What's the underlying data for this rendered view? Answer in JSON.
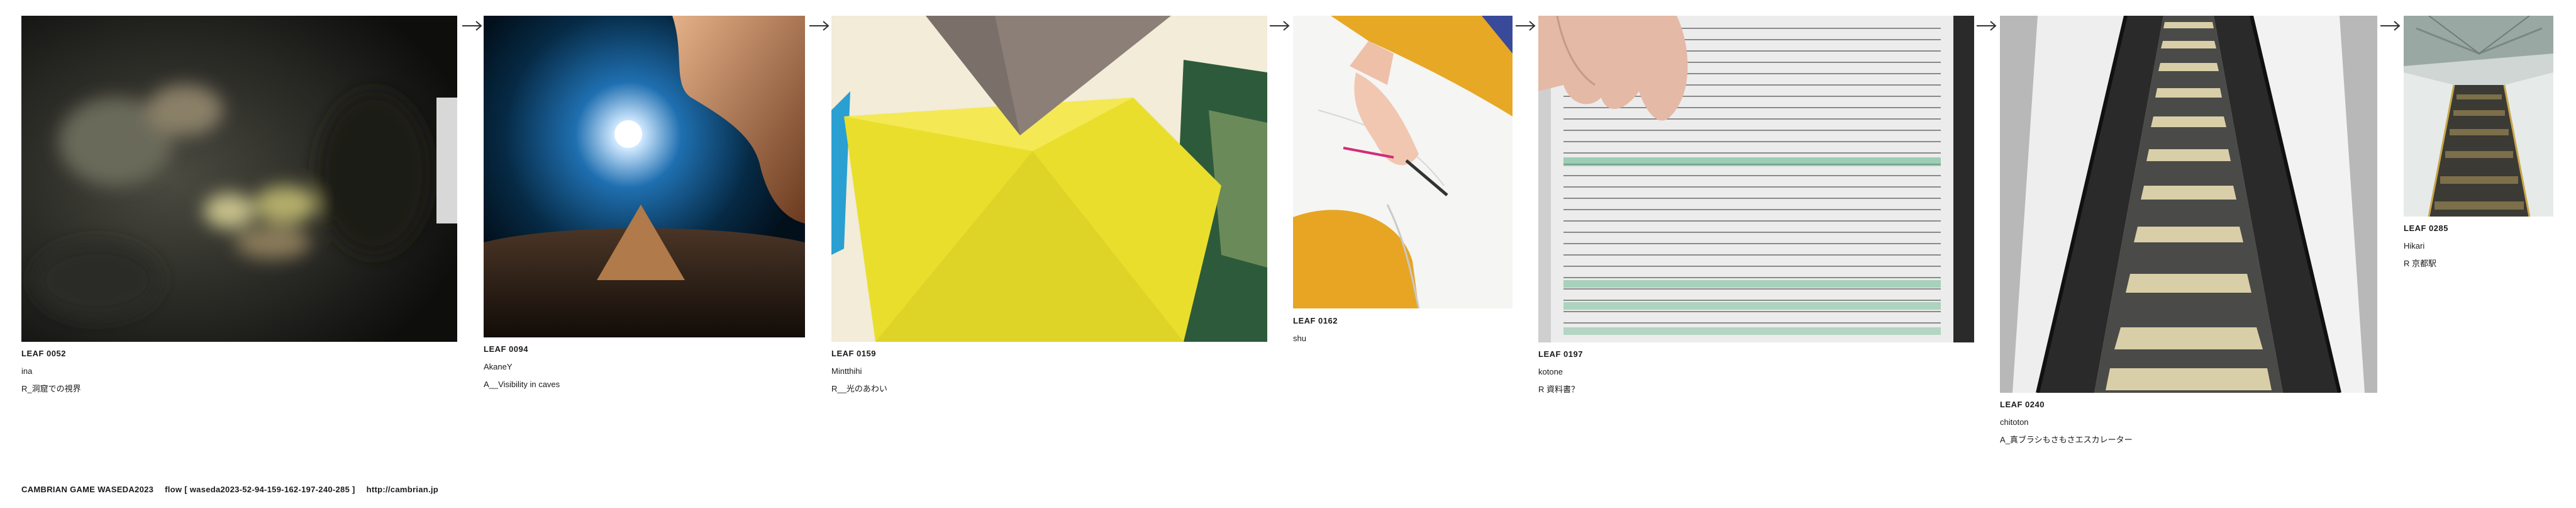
{
  "leaves": [
    {
      "id": "LEAF 0052",
      "author": "ina",
      "title": "R_洞窟での視界"
    },
    {
      "id": "LEAF 0094",
      "author": "AkaneY",
      "title": "A__Visibility in caves"
    },
    {
      "id": "LEAF 0159",
      "author": "Mintthihi",
      "title": "R__光のあわい"
    },
    {
      "id": "LEAF 0162",
      "author": "shu",
      "title": ""
    },
    {
      "id": "LEAF 0197",
      "author": "kotone",
      "title": "R 資料書？"
    },
    {
      "id": "LEAF 0240",
      "author": "chitoton",
      "title": "A_真ブラシもさもさエスカレーター"
    },
    {
      "id": "LEAF 0285",
      "author": "Hikari",
      "title": "R 京都駅"
    }
  ],
  "footer": {
    "brand": "CAMBRIAN GAME  WASEDA2023",
    "flow": "flow [ waseda2023-52-94-159-162-197-240-285 ]",
    "url": "http://cambrian.jp"
  },
  "icons": {
    "arrow": "right-arrow-icon"
  }
}
